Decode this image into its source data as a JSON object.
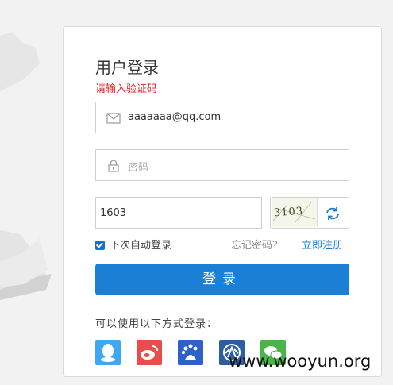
{
  "login": {
    "title": "用户登录",
    "error": "请输入验证码",
    "email_value": "aaaaaaa@qq.com",
    "password_placeholder": "密码",
    "captcha_value": "1603",
    "captcha_image_text": "3103",
    "remember_label": "下次自动登录",
    "remember_checked": true,
    "forgot_label": "忘记密码？",
    "register_label": "立即注册",
    "submit_label": "登录",
    "other_methods": "可以使用以下方式登录：",
    "social": [
      "qq-icon",
      "weibo-icon",
      "baidu-icon",
      "renren-icon",
      "wechat-icon"
    ]
  },
  "watermark": "www.wooyun.org",
  "colors": {
    "primary": "#1b80d5",
    "error": "#e02020",
    "link": "#1b7bd0"
  }
}
